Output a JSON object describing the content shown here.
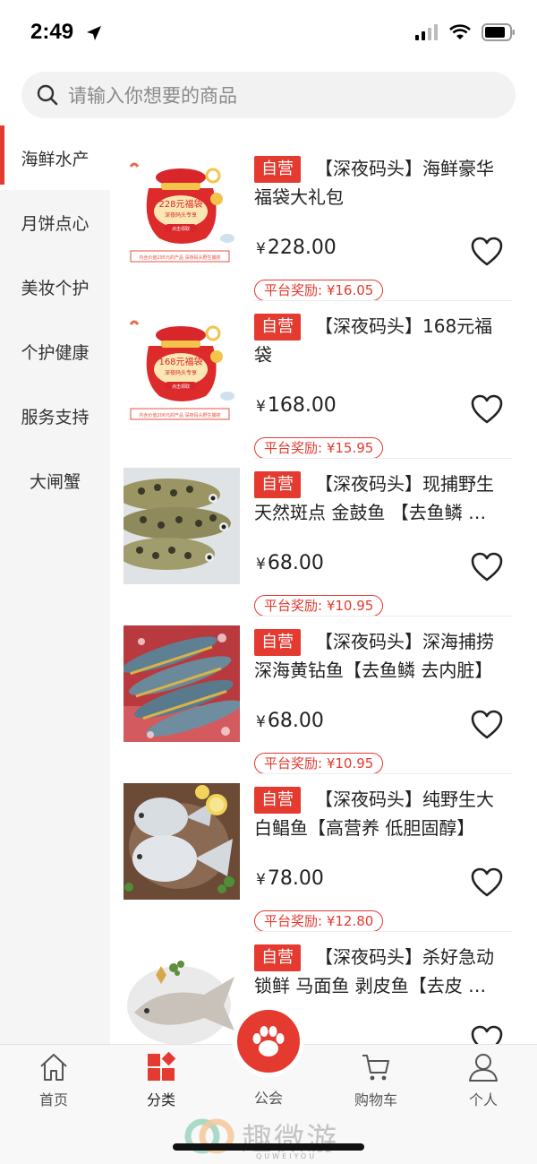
{
  "status_bar": {
    "time": "2:49"
  },
  "search": {
    "placeholder": "请输入你想要的商品"
  },
  "sidebar": {
    "items": [
      {
        "label": "海鲜水产",
        "active": true
      },
      {
        "label": "月饼点心",
        "active": false
      },
      {
        "label": "美妆个护",
        "active": false
      },
      {
        "label": "个护健康",
        "active": false
      },
      {
        "label": "服务支持",
        "active": false
      },
      {
        "label": "大闸蟹",
        "active": false
      }
    ]
  },
  "products": [
    {
      "tag": "自营",
      "title": "【深夜码头】海鲜豪华福袋大礼包",
      "currency": "¥",
      "price": "228.00",
      "reward": "平台奖励: ¥16.05",
      "image": {
        "type": "lucky-bag",
        "bag_title": "228元福袋",
        "bag_sub": "深夜码头专享",
        "bag_btn": "点击领取",
        "bag_note": "内含价值295元的产品  深夜码头野生捕捞"
      }
    },
    {
      "tag": "自营",
      "title": "【深夜码头】168元福袋",
      "currency": "¥",
      "price": "168.00",
      "reward": "平台奖励: ¥15.95",
      "image": {
        "type": "lucky-bag",
        "bag_title": "168元福袋",
        "bag_sub": "深夜码头专享",
        "bag_btn": "点击领取",
        "bag_note": "内含价值206元的产品  深夜码头野生捕捞"
      }
    },
    {
      "tag": "自营",
      "title": "【深夜码头】现捕野生天然斑点 金鼓鱼 【去鱼鳞 …",
      "currency": "¥",
      "price": "68.00",
      "reward": "平台奖励: ¥10.95",
      "image": {
        "type": "spotted-fish"
      }
    },
    {
      "tag": "自营",
      "title": "【深夜码头】深海捕捞深海黄钻鱼【去鱼鳞 去内脏】",
      "currency": "¥",
      "price": "68.00",
      "reward": "平台奖励: ¥10.95",
      "image": {
        "type": "yellow-fish"
      }
    },
    {
      "tag": "自营",
      "title": "【深夜码头】纯野生大白鲳鱼【高营养 低胆固醇】",
      "currency": "¥",
      "price": "78.00",
      "reward": "平台奖励: ¥12.80",
      "image": {
        "type": "pomfret"
      }
    },
    {
      "tag": "自营",
      "title": "【深夜码头】杀好急动锁鲜 马面鱼 剥皮鱼【去皮 …",
      "currency": "¥",
      "price": "",
      "reward": "",
      "image": {
        "type": "leatherjacket"
      }
    }
  ],
  "tabbar": {
    "tabs": [
      {
        "label": "首页",
        "icon": "home-icon"
      },
      {
        "label": "分类",
        "icon": "category-icon",
        "active": true
      },
      {
        "label": "公会",
        "icon": "paw-icon"
      },
      {
        "label": "购物车",
        "icon": "cart-icon"
      },
      {
        "label": "个人",
        "icon": "person-icon"
      }
    ]
  },
  "watermark": {
    "text": "趣微游",
    "sub": "QUWEIYOU"
  },
  "colors": {
    "accent": "#e43a2f",
    "sidebar_bg": "#f5f5f5",
    "search_bg": "#f2f2f2"
  }
}
